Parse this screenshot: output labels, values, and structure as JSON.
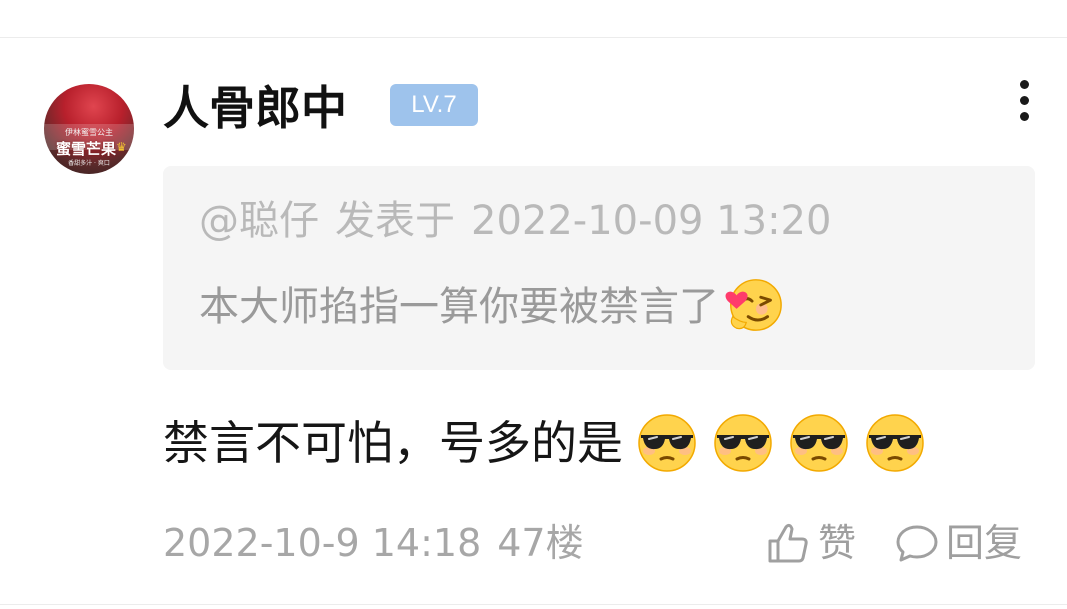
{
  "post": {
    "author": {
      "name": "人骨郎中",
      "level": "LV.7",
      "avatar": {
        "line1": "伊林蜜雪公主",
        "line2": "蜜雪芒果",
        "line3": "香甜多汁 · 爽口"
      }
    },
    "menu_icon": "more-vertical-icon",
    "quote": {
      "user": "@聪仔",
      "action": "发表于",
      "datetime": "2022-10-09 13:20",
      "text": "本大师掐指一算你要被禁言了",
      "emoji": "wink-heart-emoji"
    },
    "comment": {
      "text": "禁言不可怕，号多的是",
      "emojis": [
        "sunglasses-emoji",
        "sunglasses-emoji",
        "sunglasses-emoji",
        "sunglasses-emoji"
      ]
    },
    "footer": {
      "datetime": "2022-10-9 14:18",
      "floor": "47楼",
      "like_label": "赞",
      "reply_label": "回复"
    }
  },
  "colors": {
    "level_badge_bg": "#9ec3ec",
    "quote_bg": "#f5f5f5",
    "muted_text": "#a7a7a7",
    "primary_text": "#161616"
  }
}
